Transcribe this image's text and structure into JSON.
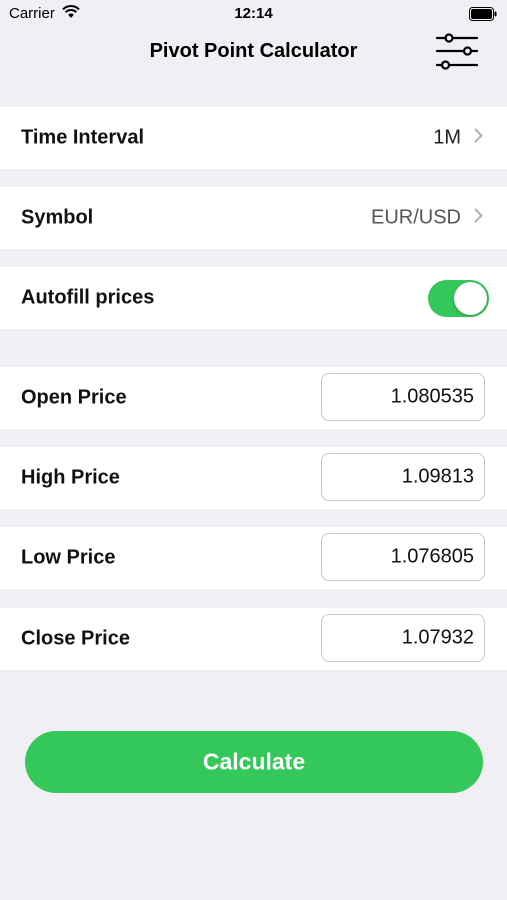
{
  "status_bar": {
    "carrier": "Carrier",
    "time": "12:14"
  },
  "nav": {
    "title": "Pivot Point Calculator",
    "settings_icon": "sliders-icon"
  },
  "settings": {
    "time_interval": {
      "label": "Time Interval",
      "value": "1M"
    },
    "symbol": {
      "label": "Symbol",
      "value": "EUR/USD"
    },
    "autofill": {
      "label": "Autofill prices",
      "enabled": true
    }
  },
  "prices": {
    "open": {
      "label": "Open Price",
      "value": "1.080535"
    },
    "high": {
      "label": "High Price",
      "value": "1.09813"
    },
    "low": {
      "label": "Low Price",
      "value": "1.076805"
    },
    "close": {
      "label": "Close Price",
      "value": "1.07932"
    }
  },
  "actions": {
    "calculate_label": "Calculate"
  },
  "colors": {
    "accent": "#34c759",
    "background": "#efeff4"
  }
}
